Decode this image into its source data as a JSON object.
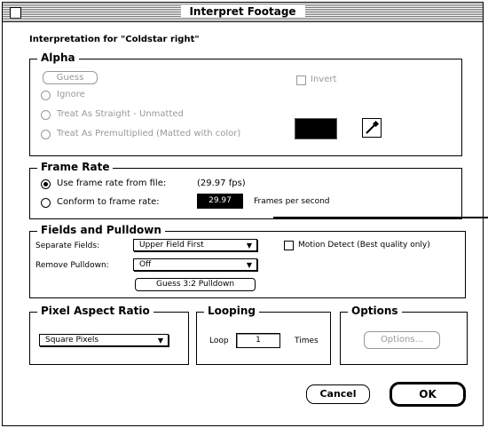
{
  "window": {
    "title": "Interpret Footage"
  },
  "interpretation_label": "Interpretation for \"Coldstar right\"",
  "alpha": {
    "title": "Alpha",
    "guess_label": "Guess",
    "invert_label": "Invert",
    "options": [
      {
        "label": "Ignore",
        "selected": false
      },
      {
        "label": "Treat As Straight - Unmatted",
        "selected": false
      },
      {
        "label": "Treat As Premultiplied (Matted with color)",
        "selected": false
      }
    ],
    "matte_color": "#000000",
    "eyedropper_icon": "eyedropper-icon"
  },
  "frame_rate": {
    "title": "Frame Rate",
    "use_file_label": "Use frame rate from file:",
    "file_rate_value": "(29.97 fps)",
    "conform_label": "Conform to frame rate:",
    "conform_value": "29.97",
    "unit_label": "Frames per second"
  },
  "fields": {
    "title": "Fields and Pulldown",
    "separate_label": "Separate Fields:",
    "separate_value": "Upper Field First",
    "motion_label": "Motion Detect (Best quality only)",
    "remove_label": "Remove Pulldown:",
    "remove_value": "Off",
    "guess_button": "Guess 3:2 Pulldown"
  },
  "pixel_aspect": {
    "title": "Pixel Aspect Ratio",
    "value": "Square Pixels"
  },
  "looping": {
    "title": "Looping",
    "loop_label": "Loop",
    "loop_value": "1",
    "times_label": "Times"
  },
  "options_group": {
    "title": "Options",
    "button": "Options..."
  },
  "buttons": {
    "cancel": "Cancel",
    "ok": "OK"
  },
  "icons": {
    "close": "close-box-icon",
    "popup_arrow": "▼"
  }
}
